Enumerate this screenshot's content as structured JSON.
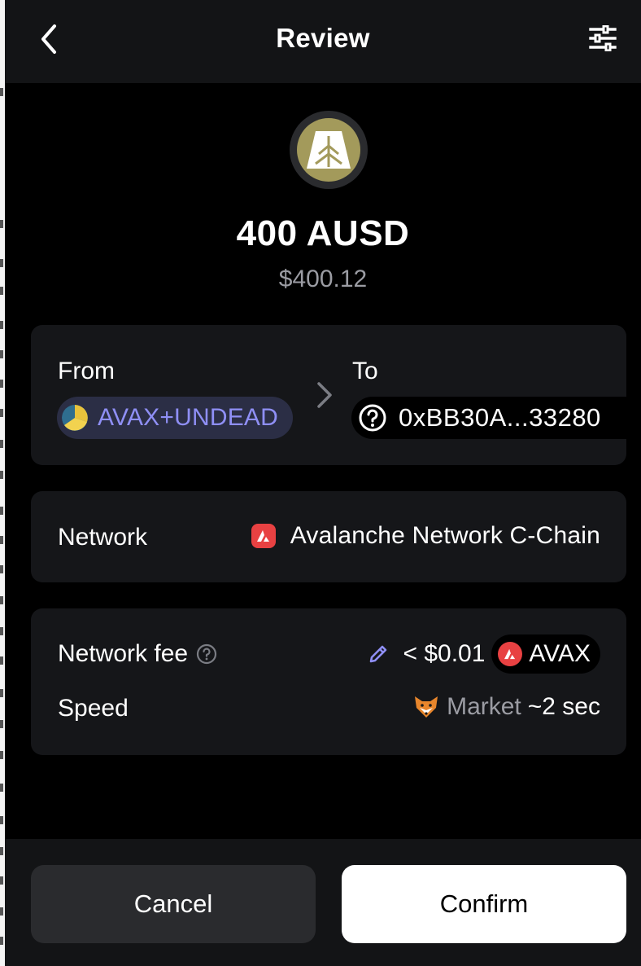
{
  "header": {
    "title": "Review",
    "back_icon": "chevron-left-icon",
    "settings_icon": "sliders-icon"
  },
  "token": {
    "logo_icon": "ausd-token-icon",
    "amount": "400 AUSD",
    "usd_value": "$400.12"
  },
  "transfer": {
    "from_label": "From",
    "from_account": "AVAX+UNDEAD",
    "to_label": "To",
    "to_address": "0xBB30A...33280"
  },
  "network": {
    "label": "Network",
    "value": "Avalanche Network C-Chain"
  },
  "fee": {
    "label": "Network fee",
    "amount": "< $0.01",
    "token": "AVAX",
    "speed_label": "Speed",
    "speed_option": "Market",
    "speed_time": "~2 sec"
  },
  "actions": {
    "cancel": "Cancel",
    "confirm": "Confirm"
  },
  "colors": {
    "background": "#000000",
    "surface": "#151619",
    "accent_purple": "#8f8ff5",
    "avalanche_red": "#e84142",
    "muted_text": "#9b9ca3"
  }
}
